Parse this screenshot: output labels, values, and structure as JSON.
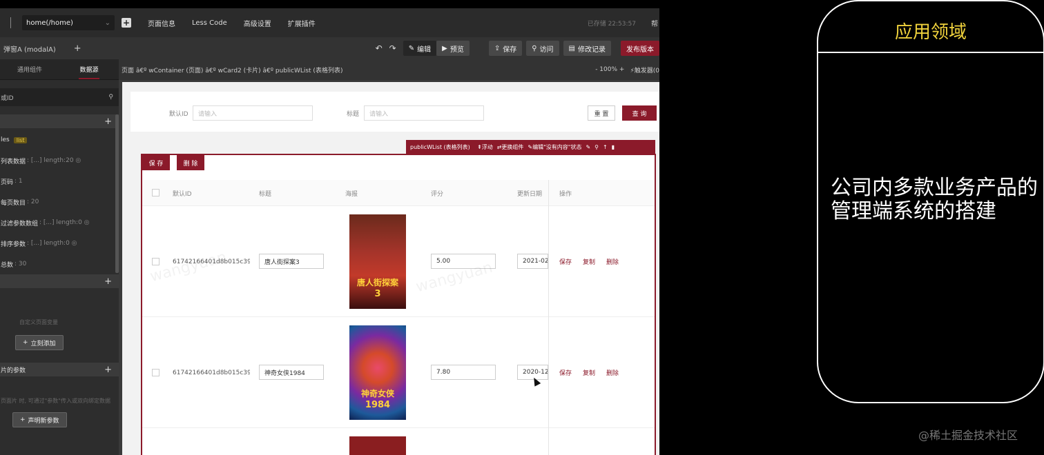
{
  "menubar": {
    "route": "home(/home)",
    "add": "+",
    "items": [
      "页面信息",
      "Less Code",
      "高级设置",
      "扩展插件"
    ],
    "saved": "已存储 22:53:57",
    "more": "帮"
  },
  "toolbar": {
    "modal_tab": "弹窗A (modalA)",
    "add_tab": "+",
    "undo": "↶",
    "redo": "↷",
    "edit": "编辑",
    "preview": "预览",
    "save": "保存",
    "visit": "访问",
    "history": "修改记录",
    "publish": "发布版本"
  },
  "sidebar": {
    "tabs": [
      "通用组件",
      "数据源"
    ],
    "search": "或ID",
    "section_add": "+",
    "vars": [
      {
        "name": "les",
        "tag": "list"
      },
      {
        "name": "列表数据",
        "meta": ": [...] length:20 ◎"
      },
      {
        "name": "页码",
        "meta": ": 1"
      },
      {
        "name": "每页数目",
        "meta": ": 20"
      },
      {
        "name": "过滤参数数组",
        "meta": ": [...] length:0 ◎"
      },
      {
        "name": "排序参数",
        "meta": ": [...] length:0 ◎"
      },
      {
        "name": "总数",
        "meta": ": 30"
      }
    ],
    "custom_empty": "自定义页面变量",
    "add_now": "立刻添加",
    "params_title": "片的参数",
    "params_hint": "页面片 时, 可通过\"参数\"传入或双向绑定数据",
    "declare_param": "声明新参数"
  },
  "breadcrumb": {
    "text": "页面 â€º wContainer (页面) â€º wCard2 (卡片) â€º publicWList (表格列表)",
    "zoom": "-   100%   +",
    "trigger": "⚡触发器(0"
  },
  "filter": {
    "id_label": "默认ID",
    "id_placeholder": "请输入",
    "title_label": "标题",
    "title_placeholder": "请输入",
    "reset": "重 置",
    "query": "查 询"
  },
  "component_bar": {
    "name": "publicWList (表格列表)",
    "actions": [
      "浮动",
      "更换组件",
      "编辑\"没有内容\"状态"
    ]
  },
  "table": {
    "save": "保 存",
    "delete": "删 除",
    "headers": [
      "默认ID",
      "标题",
      "海报",
      "评分",
      "更新日期",
      "操作"
    ],
    "rows": [
      {
        "id": "61742166401d8b015c393",
        "title": "唐人街探案3",
        "poster_text": "唐人街探案",
        "poster_num": "3",
        "rating": "5.00",
        "date": "2021-02",
        "ops": [
          "保存",
          "复制",
          "删除"
        ]
      },
      {
        "id": "61742166401d8b015c393",
        "title": "神奇女侠1984",
        "poster_text": "神奇女侠",
        "poster_num": "1984",
        "rating": "7.80",
        "date": "2020-12",
        "ops": [
          "保存",
          "复制",
          "删除"
        ]
      }
    ]
  },
  "watermark": "wangyuan",
  "card": {
    "title": "应用领域",
    "body": "公司内多款业务产品的管理端系统的搭建"
  },
  "credit": "@稀土掘金技术社区",
  "colors": {
    "accent": "#8b1a2a",
    "card_title": "#f0d23c"
  }
}
